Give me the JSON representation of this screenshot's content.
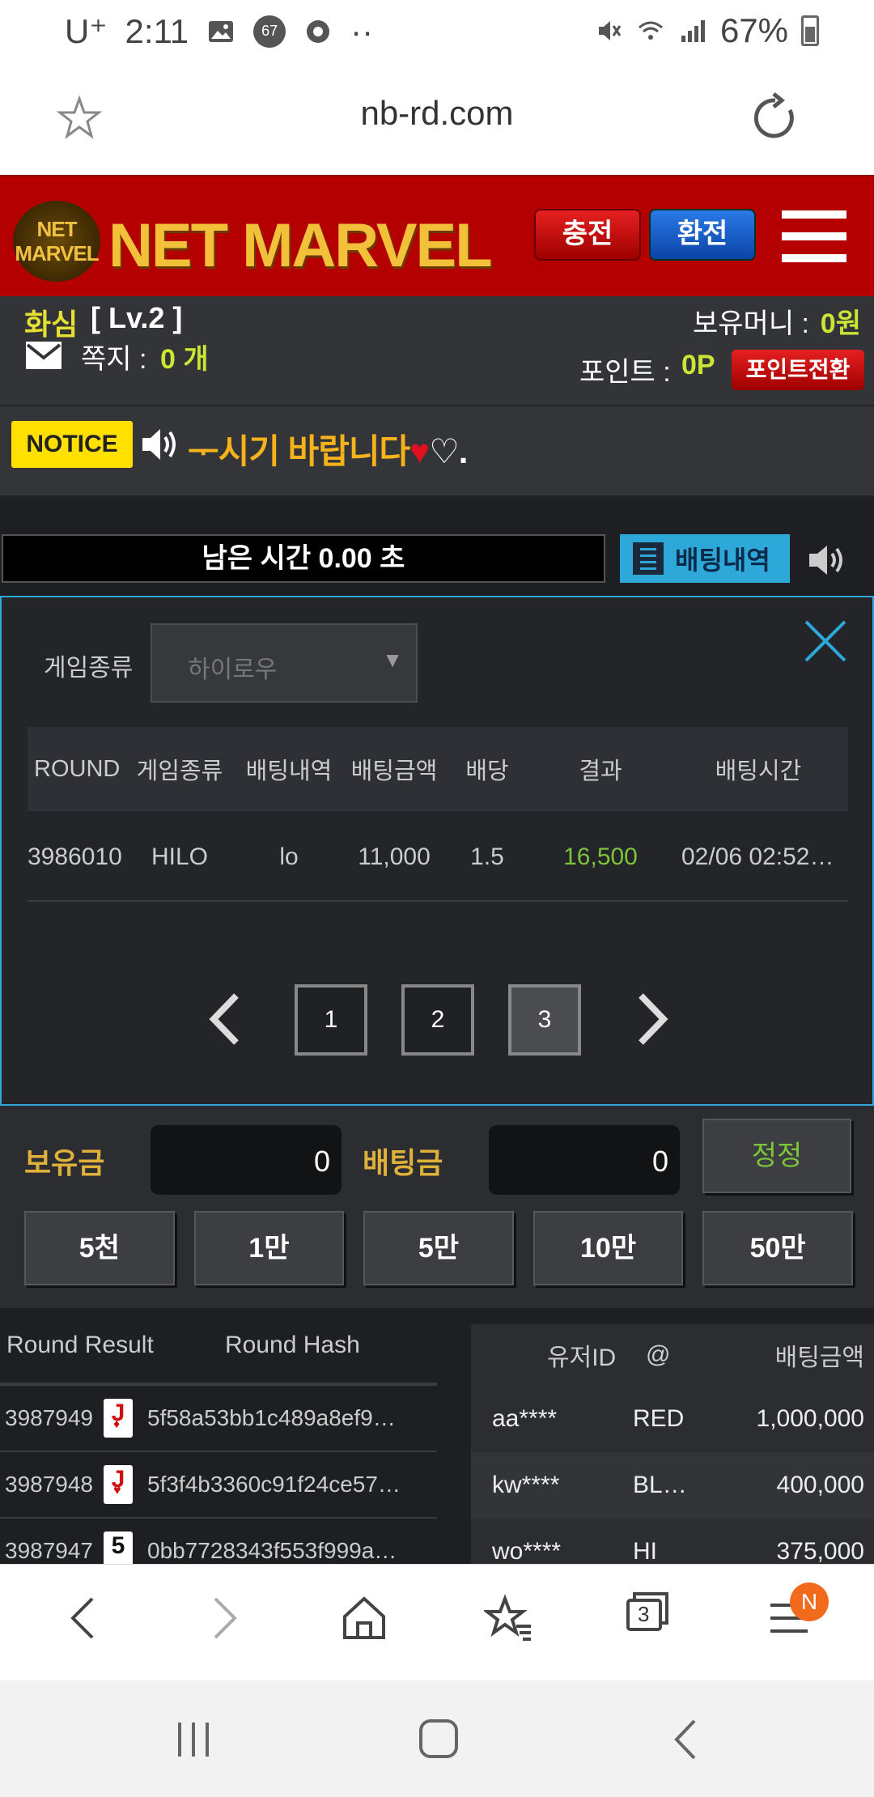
{
  "status_bar": {
    "carrier": "U⁺",
    "time": "2:11",
    "badge": "67",
    "dots": "··",
    "battery": "67%"
  },
  "url_bar": {
    "url": "nb-rd.com"
  },
  "header": {
    "logo_badge": "NET MARVEL",
    "logo_text": "NET MARVEL",
    "charge_label": "충전",
    "exchange_label": "환전"
  },
  "user": {
    "nickname": "화심",
    "level": "[ Lv.2 ]",
    "message_label": "쪽지 :",
    "message_count": "0 개",
    "money_label": "보유머니 :",
    "money_value": "0원",
    "point_label": "포인트 :",
    "point_value": "0P",
    "point_convert_label": "포인트전환"
  },
  "notice": {
    "badge": "NOTICE",
    "text": "ᅮ시기 바랍니다"
  },
  "timer": {
    "label": "남은 시간 0.00 초",
    "history_label": "배팅내역"
  },
  "modal": {
    "game_type_label": "게임종류",
    "select_value": "하이로우",
    "columns": [
      "ROUND",
      "게임종류",
      "배팅내역",
      "배팅금액",
      "배당",
      "결과",
      "배팅시간"
    ],
    "rows": [
      {
        "round": "3986010",
        "game": "HILO",
        "bet": "lo",
        "amount": "11,000",
        "odds": "1.5",
        "result": "16,500",
        "time": "02/06 02:52…"
      }
    ],
    "pages": [
      "1",
      "2",
      "3"
    ],
    "active_page": "3"
  },
  "bet_panel": {
    "holding_label": "보유금",
    "holding_value": "0",
    "bet_label": "배팅금",
    "bet_value": "0",
    "fix_label": "정정",
    "chips": [
      "5천",
      "1만",
      "5만",
      "10만",
      "50만"
    ]
  },
  "round_table": {
    "col_result": "Round Result",
    "col_hash": "Round Hash",
    "rows": [
      {
        "round": "3987949",
        "card": "J",
        "suit": "♦",
        "color": "red",
        "hash": "5f58a53bb1c489a8ef9…"
      },
      {
        "round": "3987948",
        "card": "J",
        "suit": "♥",
        "color": "red",
        "hash": "5f3f4b3360c91f24ce57…"
      },
      {
        "round": "3987947",
        "card": "5",
        "suit": "",
        "color": "black",
        "hash": "0bb7728343f553f999a…"
      }
    ]
  },
  "user_bets": {
    "col_user": "유저ID",
    "col_at": "@",
    "col_amount": "배팅금액",
    "rows": [
      {
        "user": "aa****",
        "pick": "RED",
        "amount": "1,000,000"
      },
      {
        "user": "kw****",
        "pick": "BL…",
        "amount": "400,000"
      },
      {
        "user": "wo****",
        "pick": "HI",
        "amount": "375,000"
      }
    ]
  },
  "browser_bar": {
    "tabs_count": "3",
    "notification": "N"
  },
  "colors": {
    "header_red": "#b40000",
    "accent_blue": "#2ea8d8",
    "gold": "#e0b13a",
    "green": "#7cc53a"
  }
}
